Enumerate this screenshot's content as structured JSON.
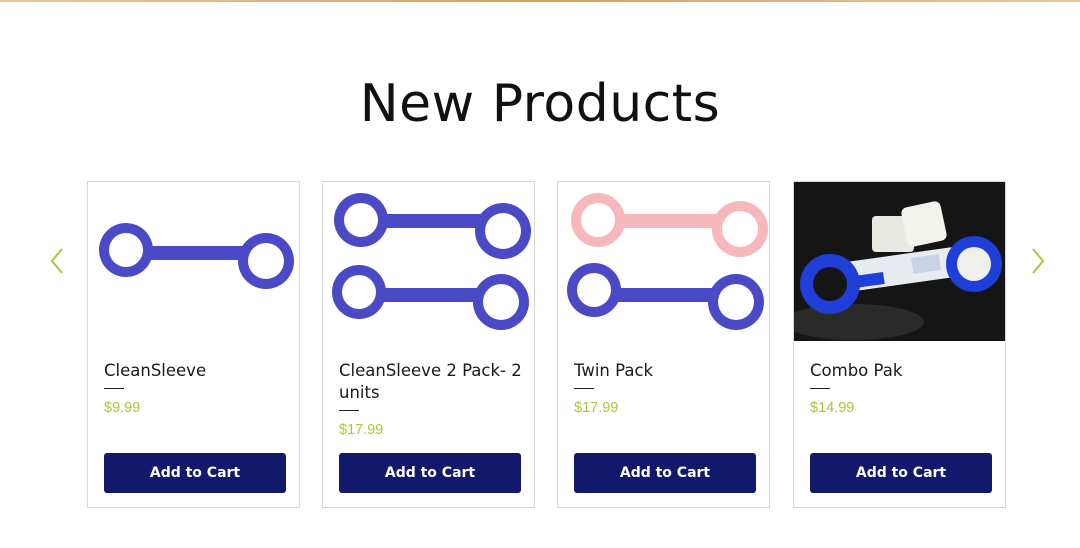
{
  "section": {
    "title": "New Products"
  },
  "colors": {
    "accent_price": "#a7c83a",
    "button_bg": "#12196b",
    "arrow": "#a7c83a"
  },
  "carousel": {
    "prev_icon": "chevron-left-icon",
    "next_icon": "chevron-right-icon",
    "products": [
      {
        "name": "CleanSleeve",
        "price": "$9.99",
        "button": "Add to Cart",
        "image": "single blue sleeve"
      },
      {
        "name": "CleanSleeve 2 Pack- 2 units",
        "price": "$17.99",
        "button": "Add to Cart",
        "image": "two blue sleeves"
      },
      {
        "name": "Twin Pack",
        "price": "$17.99",
        "button": "Add to Cart",
        "image": "pink and blue sleeve"
      },
      {
        "name": "Combo Pak",
        "price": "$14.99",
        "button": "Add to Cart",
        "image": "combo pak photo"
      }
    ]
  }
}
